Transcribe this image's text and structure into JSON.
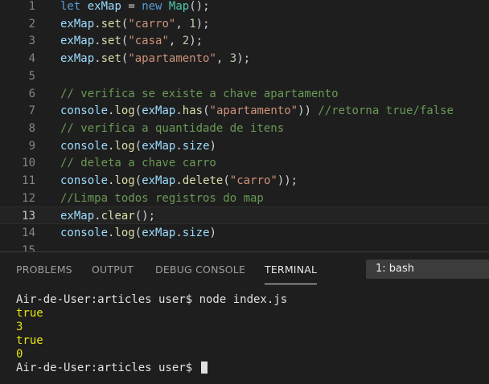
{
  "editor": {
    "active_line": 13,
    "lines": [
      {
        "num": "1",
        "tokens": [
          {
            "t": "kw",
            "v": "let"
          },
          {
            "t": "p",
            "v": " "
          },
          {
            "t": "var",
            "v": "exMap"
          },
          {
            "t": "p",
            "v": " = "
          },
          {
            "t": "kw",
            "v": "new"
          },
          {
            "t": "p",
            "v": " "
          },
          {
            "t": "cls",
            "v": "Map"
          },
          {
            "t": "p",
            "v": "();"
          }
        ]
      },
      {
        "num": "2",
        "tokens": [
          {
            "t": "var",
            "v": "exMap"
          },
          {
            "t": "p",
            "v": "."
          },
          {
            "t": "fn",
            "v": "set"
          },
          {
            "t": "p",
            "v": "("
          },
          {
            "t": "str",
            "v": "\"carro\""
          },
          {
            "t": "p",
            "v": ", "
          },
          {
            "t": "num",
            "v": "1"
          },
          {
            "t": "p",
            "v": ");"
          }
        ]
      },
      {
        "num": "3",
        "tokens": [
          {
            "t": "var",
            "v": "exMap"
          },
          {
            "t": "p",
            "v": "."
          },
          {
            "t": "fn",
            "v": "set"
          },
          {
            "t": "p",
            "v": "("
          },
          {
            "t": "str",
            "v": "\"casa\""
          },
          {
            "t": "p",
            "v": ", "
          },
          {
            "t": "num",
            "v": "2"
          },
          {
            "t": "p",
            "v": ");"
          }
        ]
      },
      {
        "num": "4",
        "tokens": [
          {
            "t": "var",
            "v": "exMap"
          },
          {
            "t": "p",
            "v": "."
          },
          {
            "t": "fn",
            "v": "set"
          },
          {
            "t": "p",
            "v": "("
          },
          {
            "t": "str",
            "v": "\"apartamento\""
          },
          {
            "t": "p",
            "v": ", "
          },
          {
            "t": "num",
            "v": "3"
          },
          {
            "t": "p",
            "v": ");"
          }
        ]
      },
      {
        "num": "5",
        "tokens": []
      },
      {
        "num": "6",
        "tokens": [
          {
            "t": "cm",
            "v": "// verifica se existe a chave apartamento"
          }
        ]
      },
      {
        "num": "7",
        "tokens": [
          {
            "t": "var",
            "v": "console"
          },
          {
            "t": "p",
            "v": "."
          },
          {
            "t": "fn",
            "v": "log"
          },
          {
            "t": "p",
            "v": "("
          },
          {
            "t": "var",
            "v": "exMap"
          },
          {
            "t": "p",
            "v": "."
          },
          {
            "t": "fn",
            "v": "has"
          },
          {
            "t": "p",
            "v": "("
          },
          {
            "t": "str",
            "v": "\"apartamento\""
          },
          {
            "t": "p",
            "v": ")) "
          },
          {
            "t": "cm",
            "v": "//retorna true/false"
          }
        ]
      },
      {
        "num": "8",
        "tokens": [
          {
            "t": "cm",
            "v": "// verifica a quantidade de itens"
          }
        ]
      },
      {
        "num": "9",
        "tokens": [
          {
            "t": "var",
            "v": "console"
          },
          {
            "t": "p",
            "v": "."
          },
          {
            "t": "fn",
            "v": "log"
          },
          {
            "t": "p",
            "v": "("
          },
          {
            "t": "var",
            "v": "exMap"
          },
          {
            "t": "p",
            "v": "."
          },
          {
            "t": "var",
            "v": "size"
          },
          {
            "t": "p",
            "v": ")"
          }
        ]
      },
      {
        "num": "10",
        "tokens": [
          {
            "t": "cm",
            "v": "// deleta a chave carro"
          }
        ]
      },
      {
        "num": "11",
        "tokens": [
          {
            "t": "var",
            "v": "console"
          },
          {
            "t": "p",
            "v": "."
          },
          {
            "t": "fn",
            "v": "log"
          },
          {
            "t": "p",
            "v": "("
          },
          {
            "t": "var",
            "v": "exMap"
          },
          {
            "t": "p",
            "v": "."
          },
          {
            "t": "fn",
            "v": "delete"
          },
          {
            "t": "p",
            "v": "("
          },
          {
            "t": "str",
            "v": "\"carro\""
          },
          {
            "t": "p",
            "v": "));"
          }
        ]
      },
      {
        "num": "12",
        "tokens": [
          {
            "t": "cm",
            "v": "//Limpa todos registros do map"
          }
        ]
      },
      {
        "num": "13",
        "tokens": [
          {
            "t": "var",
            "v": "exMap"
          },
          {
            "t": "p",
            "v": "."
          },
          {
            "t": "fn",
            "v": "clear"
          },
          {
            "t": "p",
            "v": "();"
          }
        ]
      },
      {
        "num": "14",
        "tokens": [
          {
            "t": "var",
            "v": "console"
          },
          {
            "t": "p",
            "v": "."
          },
          {
            "t": "fn",
            "v": "log"
          },
          {
            "t": "p",
            "v": "("
          },
          {
            "t": "var",
            "v": "exMap"
          },
          {
            "t": "p",
            "v": "."
          },
          {
            "t": "var",
            "v": "size"
          },
          {
            "t": "p",
            "v": ")"
          }
        ]
      },
      {
        "num": "15",
        "tokens": []
      }
    ]
  },
  "panel": {
    "tabs": {
      "problems": "PROBLEMS",
      "output": "OUTPUT",
      "debug_console": "DEBUG CONSOLE",
      "terminal": "TERMINAL"
    },
    "active_tab": "TERMINAL",
    "terminal_selector": "1: bash"
  },
  "terminal": {
    "lines": [
      {
        "kind": "prompt",
        "text": "Air-de-User:articles user$ node index.js"
      },
      {
        "kind": "out",
        "text": "true"
      },
      {
        "kind": "out",
        "text": "3"
      },
      {
        "kind": "out",
        "text": "true"
      },
      {
        "kind": "out",
        "text": "0"
      },
      {
        "kind": "prompt",
        "text": "Air-de-User:articles user$ ",
        "cursor": true
      }
    ]
  },
  "colors": {
    "background": "#1e1e1e",
    "keyword": "#569cd6",
    "variable": "#9cdcfe",
    "function": "#dcdcaa",
    "class": "#4ec9b0",
    "string": "#ce9178",
    "number": "#b5cea8",
    "comment": "#6a9955",
    "terminal_output": "#e5e510"
  }
}
